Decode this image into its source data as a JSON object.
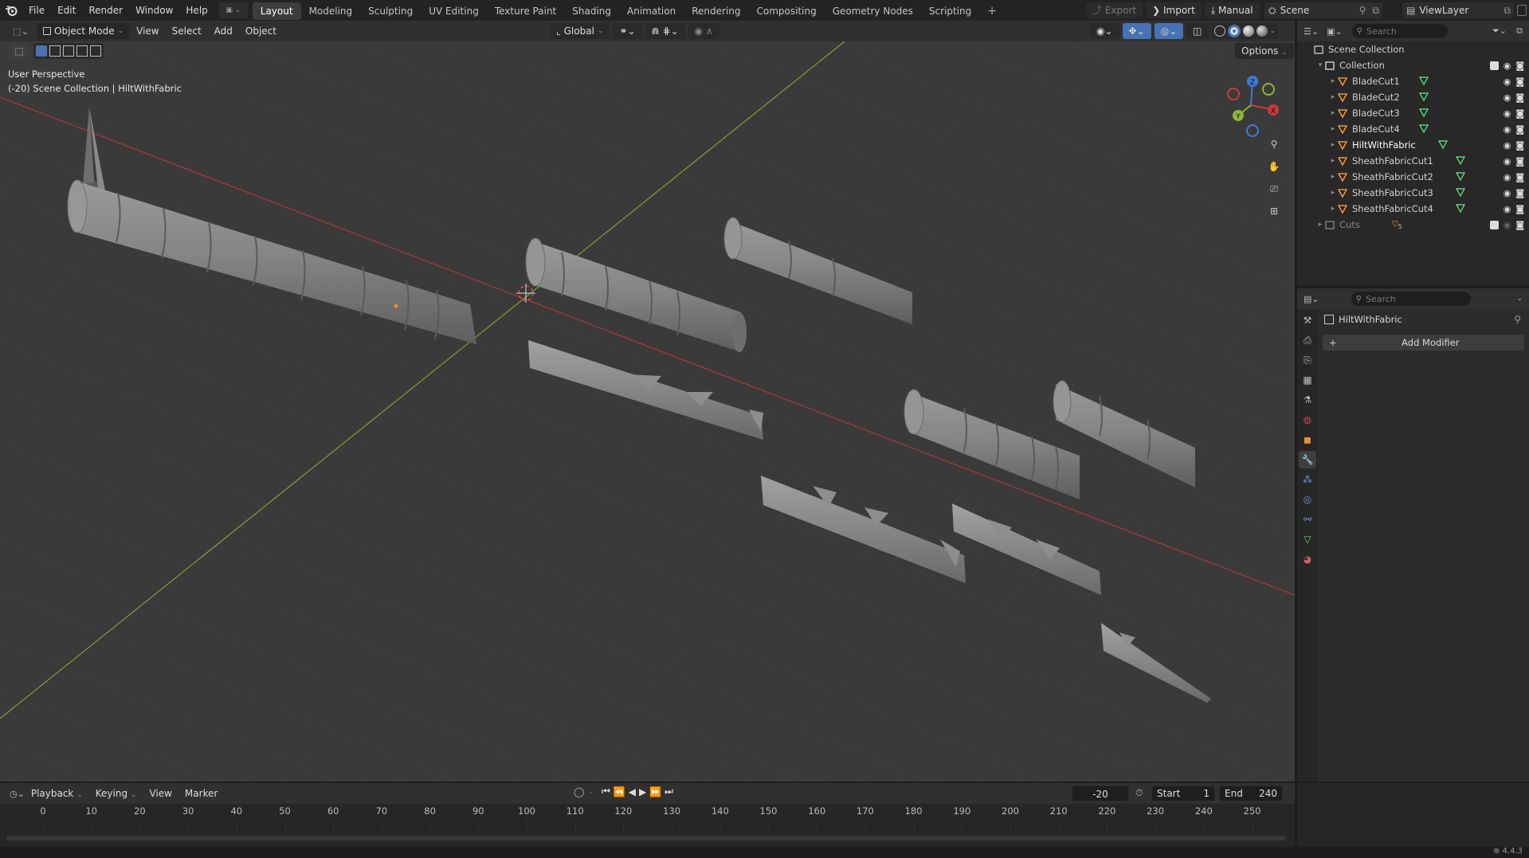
{
  "topbar": {
    "menus": [
      "File",
      "Edit",
      "Render",
      "Window",
      "Help"
    ],
    "workspaces": [
      "Layout",
      "Modeling",
      "Sculpting",
      "UV Editing",
      "Texture Paint",
      "Shading",
      "Animation",
      "Rendering",
      "Compositing",
      "Geometry Nodes",
      "Scripting"
    ],
    "active_workspace": "Layout",
    "export_label": "Export",
    "import_label": "Import",
    "manual_label": "Manual",
    "scene_name": "Scene",
    "view_layer": "ViewLayer"
  },
  "viewport_header": {
    "mode": "Object Mode",
    "menus": [
      "View",
      "Select",
      "Add",
      "Object"
    ],
    "orientation": "Global",
    "options_label": "Options"
  },
  "viewport": {
    "perspective_label": "User Perspective",
    "context_label": "(-20) Scene Collection | HiltWithFabric",
    "gizmo": {
      "z": "Z",
      "y": "Y",
      "x": "X"
    }
  },
  "outliner": {
    "search_placeholder": "Search",
    "root": "Scene Collection",
    "collection": "Collection",
    "items": [
      {
        "name": "BladeCut1"
      },
      {
        "name": "BladeCut2"
      },
      {
        "name": "BladeCut3"
      },
      {
        "name": "BladeCut4"
      },
      {
        "name": "HiltWithFabric",
        "selected": true
      },
      {
        "name": "SheathFabricCut1"
      },
      {
        "name": "SheathFabricCut2"
      },
      {
        "name": "SheathFabricCut3"
      },
      {
        "name": "SheathFabricCut4"
      }
    ],
    "cuts_collection": "Cuts",
    "cuts_count": "5"
  },
  "properties": {
    "search_placeholder": "Search",
    "object_name": "HiltWithFabric",
    "add_modifier_label": "Add Modifier"
  },
  "timeline": {
    "menus": [
      "Playback",
      "Keying",
      "View",
      "Marker"
    ],
    "current_frame": "-20",
    "start_label": "Start",
    "start_value": "1",
    "end_label": "End",
    "end_value": "240",
    "frame_labels": [
      "0",
      "10",
      "20",
      "30",
      "40",
      "50",
      "60",
      "70",
      "80",
      "90",
      "100",
      "110",
      "120",
      "130",
      "140",
      "150",
      "160",
      "170",
      "180",
      "190",
      "200",
      "210",
      "220",
      "230",
      "240",
      "250"
    ]
  },
  "statusbar": {
    "version": "4.4.3"
  },
  "colors": {
    "accent_orange": "#e8923a",
    "mesh_green": "#5fd07a",
    "axis_x_red": "#c8393f",
    "axis_y_green": "#8cb53a",
    "axis_z_blue": "#3d7bd6",
    "active_blue": "#4772b3"
  }
}
